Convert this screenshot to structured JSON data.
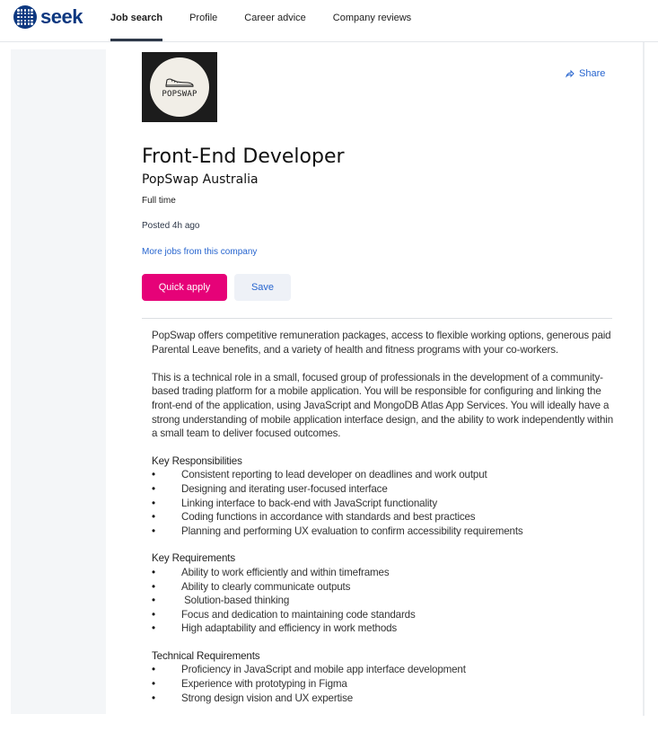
{
  "brand": {
    "logo_text": "seek",
    "logo_color": "#0d3880"
  },
  "nav": {
    "tabs": [
      {
        "label": "Job search",
        "active": true
      },
      {
        "label": "Profile",
        "active": false
      },
      {
        "label": "Career advice",
        "active": false
      },
      {
        "label": "Company reviews",
        "active": false
      }
    ]
  },
  "job": {
    "company_logo_text": "POPSWAP",
    "share_label": "Share",
    "title": "Front-End Developer",
    "company": "PopSwap Australia",
    "work_type": "Full time",
    "posted": "Posted 4h ago",
    "more_jobs_link": "More jobs from this company",
    "apply_label": "Quick apply",
    "save_label": "Save"
  },
  "description": {
    "paragraphs": [
      "PopSwap offers competitive remuneration packages, access to flexible working options, generous paid Parental Leave benefits, and a variety of health and fitness programs with your co-workers.",
      "This is a technical role in a small, focused group of professionals in the development of a community-based trading platform for a mobile application. You will be responsible for configuring and linking the front-end of the application, using JavaScript and MongoDB Atlas App Services. You will ideally have a strong understanding of mobile application interface design, and the ability to work independently within a small team to deliver focused outcomes."
    ],
    "sections": [
      {
        "heading": "Key Responsibilities",
        "items": [
          "Consistent reporting to lead developer on deadlines and work output",
          "Designing and iterating user-focused interface",
          "Linking interface to back-end with JavaScript functionality",
          "Coding functions in accordance with standards and best practices",
          "Planning and performing UX evaluation to confirm accessibility requirements"
        ]
      },
      {
        "heading": "Key Requirements",
        "items": [
          "Ability to work efficiently and within timeframes",
          "Ability to clearly communicate outputs",
          " Solution-based thinking",
          "Focus and dedication to maintaining code standards",
          "High adaptability and efficiency in work methods"
        ]
      },
      {
        "heading": "Technical Requirements",
        "items": [
          "Proficiency in JavaScript and mobile app interface development",
          "Experience with prototyping in Figma",
          "Strong design vision and UX expertise"
        ]
      }
    ]
  },
  "colors": {
    "accent_pink": "#e60278",
    "link_blue": "#2765cf",
    "save_bg": "#eef1f7"
  }
}
